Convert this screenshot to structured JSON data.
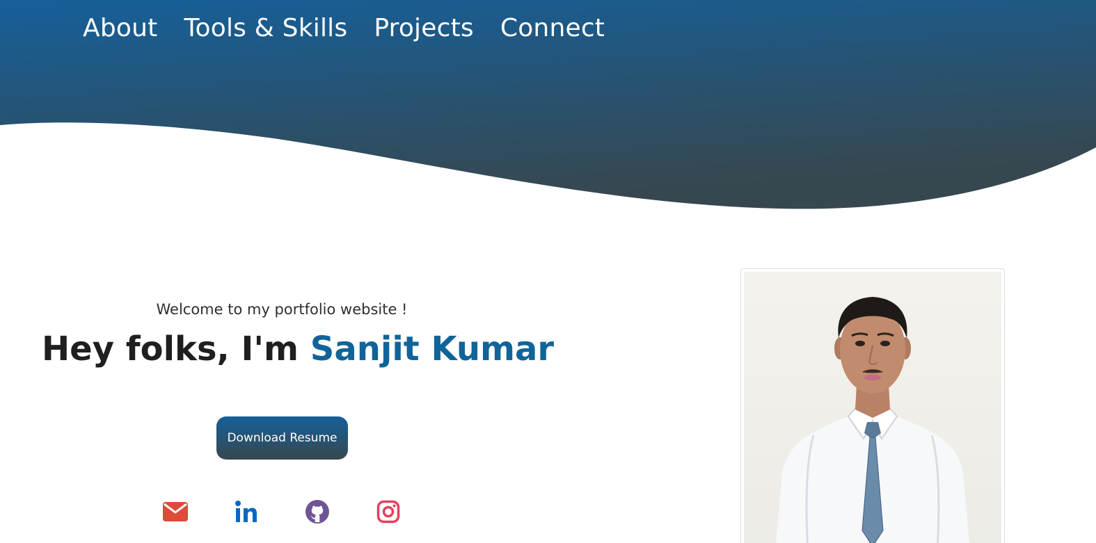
{
  "nav": {
    "items": [
      {
        "label": "About"
      },
      {
        "label": "Tools & Skills"
      },
      {
        "label": "Projects"
      },
      {
        "label": "Connect"
      }
    ]
  },
  "intro": {
    "welcome": "Welcome to my portfolio website !",
    "greeting": "Hey folks, I'm ",
    "name": "Sanjit Kumar"
  },
  "resume_button": {
    "label": "Download Resume"
  },
  "socials": [
    {
      "icon": "mail-icon",
      "color": "#dd4b39"
    },
    {
      "icon": "linkedin-icon",
      "color": "#0a66c2"
    },
    {
      "icon": "github-icon",
      "color": "#6e5494"
    },
    {
      "icon": "instagram-icon",
      "color": "#e4405f"
    }
  ],
  "colors": {
    "hero_gradient_start": "#15609a",
    "hero_gradient_end": "#37474f",
    "accent": "#10649a"
  }
}
